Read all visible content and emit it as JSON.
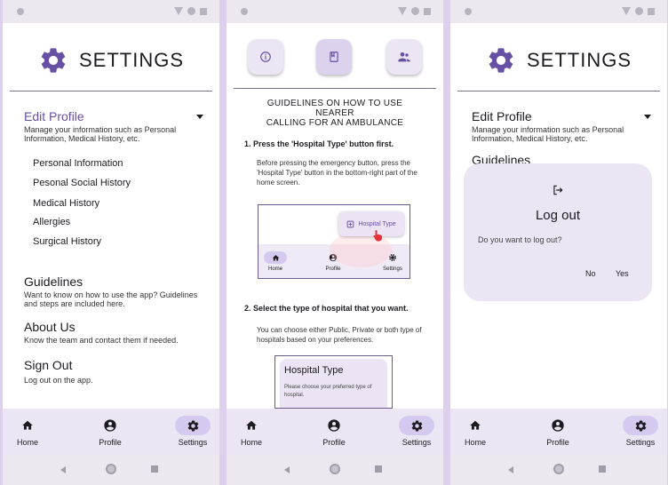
{
  "colors": {
    "accent": "#6750a4",
    "nav_background": "#ece5f4",
    "active_pill": "#d6c9f0"
  },
  "settings": {
    "title": "SETTINGS",
    "edit_profile": {
      "title": "Edit Profile",
      "description": "Manage your information such as Personal Information, Medical History, etc.",
      "items": [
        "Personal Information",
        "Pesonal Social History",
        "Medical History",
        "Allergies",
        "Surgical History"
      ]
    },
    "guidelines": {
      "title": "Guidelines",
      "description": "Want to know on how to use the app? Guidelines and steps are included here."
    },
    "about": {
      "title": "About Us",
      "description": "Know the team and contact them if needed."
    },
    "signout": {
      "title": "Sign Out",
      "description": "Log out on the app."
    }
  },
  "nav": {
    "home": "Home",
    "profile": "Profile",
    "settings": "Settings"
  },
  "guide": {
    "title_line1": "GUIDELINES ON HOW TO USE",
    "title_line2": "NEARER",
    "title_line3": "CALLING FOR AN AMBULANCE",
    "step1_title": "1. Press the 'Hospital Type' button first.",
    "step1_text": "Before pressing the emergency button, press the 'Hospital Type' button in the bottom-right part of the home screen.",
    "demo1": {
      "button": "Hospital Type",
      "home": "Home",
      "profile": "Profile",
      "settings": "Settings"
    },
    "step2_title": "2. Select the type of hospital that you want.",
    "step2_text": "You can choose either Public, Private or both type of hospitals based on your preferences.",
    "demo2": {
      "title": "Hospital Type",
      "text": "Please choose your preferred type of hospital."
    }
  },
  "dialog": {
    "icon": "logout-icon",
    "title": "Log out",
    "message": "Do you want to log out?",
    "no": "No",
    "yes": "Yes"
  },
  "panel3": {
    "edit_title": "Edit Profile",
    "edit_desc": "Manage your information such as Personal Information, Medical History, etc.",
    "guidelines": "Guidelines"
  }
}
